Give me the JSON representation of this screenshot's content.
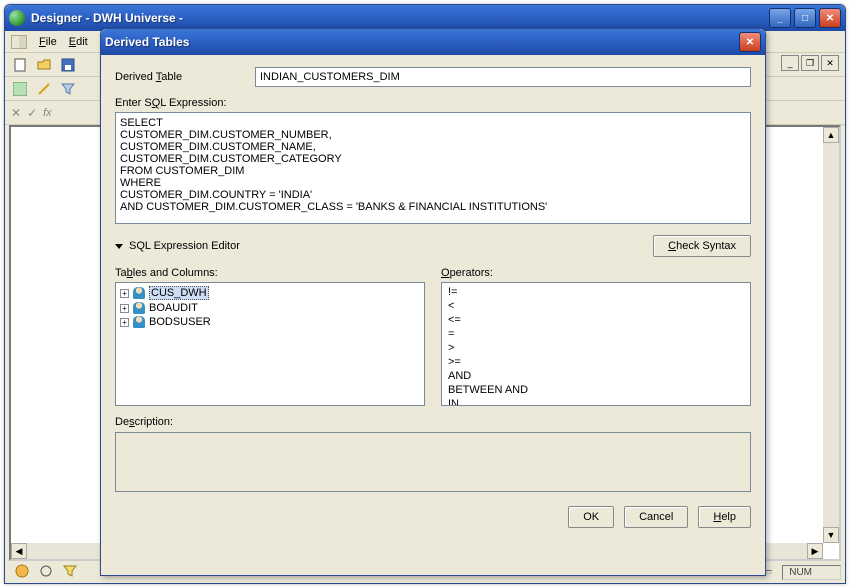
{
  "parent_window": {
    "title": "Designer - DWH Universe -",
    "menubar": {
      "file": "File",
      "edit": "Edit"
    }
  },
  "statusbar": {
    "num": "NUM"
  },
  "dialog": {
    "title": "Derived Tables",
    "derived_table_label": "Derived Table",
    "derived_table_value": "INDIAN_CUSTOMERS_DIM",
    "enter_sql_label": "Enter SQL Expression:",
    "sql_text": "SELECT\nCUSTOMER_DIM.CUSTOMER_NUMBER,\nCUSTOMER_DIM.CUSTOMER_NAME,\nCUSTOMER_DIM.CUSTOMER_CATEGORY\nFROM CUSTOMER_DIM\nWHERE\nCUSTOMER_DIM.COUNTRY = 'INDIA'\nAND CUSTOMER_DIM.CUSTOMER_CLASS = 'BANKS & FINANCIAL INSTITUTIONS'",
    "expression_editor_label": "SQL Expression Editor",
    "check_syntax_label": "Check Syntax",
    "tables_label": "Tables and Columns:",
    "tables": [
      "CUS_DWH",
      "BOAUDIT",
      "BODSUSER"
    ],
    "operators_label": "Operators:",
    "operators": [
      "!=",
      "<",
      "<=",
      "=",
      ">",
      ">=",
      "AND",
      "BETWEEN  AND",
      "IN"
    ],
    "description_label": "Description:",
    "buttons": {
      "ok": "OK",
      "cancel": "Cancel",
      "help": "Help"
    }
  }
}
